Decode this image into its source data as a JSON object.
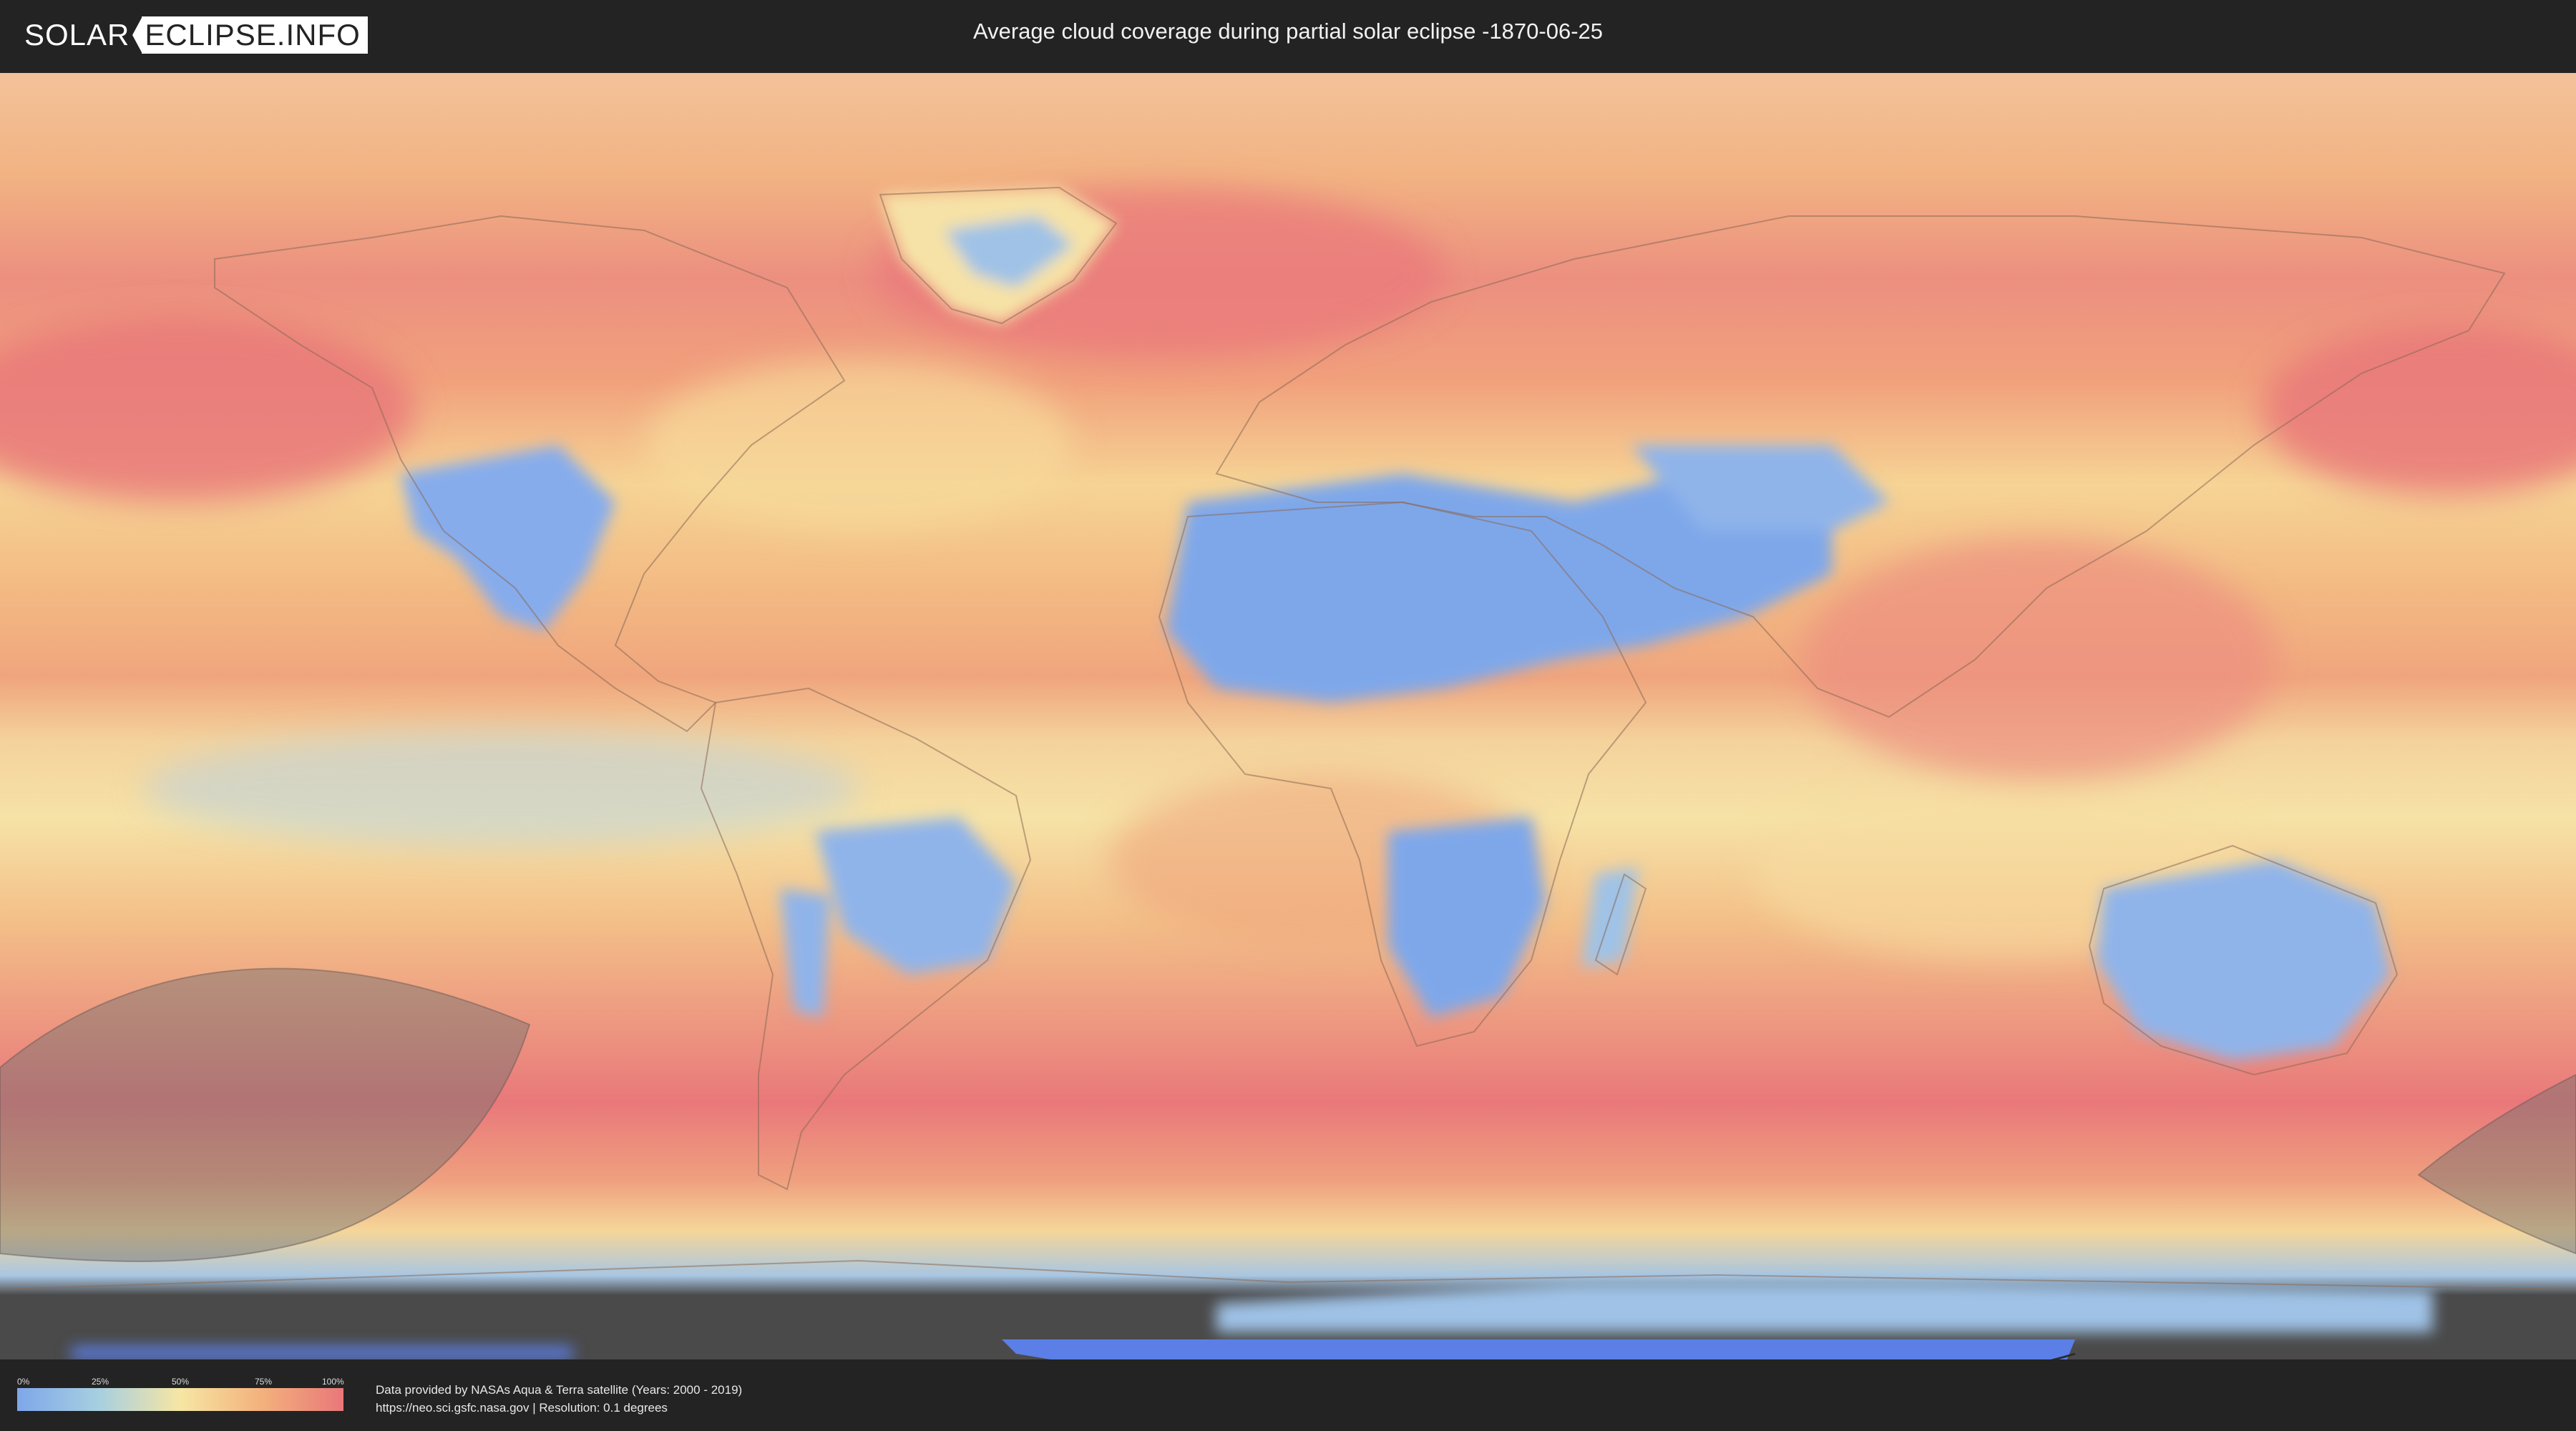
{
  "header": {
    "logo_left": "SOLAR",
    "logo_right": "ECLIPSE.INFO",
    "title": "Average cloud coverage during partial solar eclipse -1870-06-25"
  },
  "legend": {
    "ticks": [
      "0%",
      "25%",
      "50%",
      "75%",
      "100%"
    ],
    "colors": [
      "#7ea7ea",
      "#a7cfe0",
      "#f6e6a4",
      "#f3b17c",
      "#e9777a"
    ]
  },
  "footer": {
    "line1": "Data provided by NASAs Aqua & Terra satellite (Years: 2000 - 2019)",
    "line2": "https://neo.sci.gsfc.nasa.gov | Resolution: 0.1 degrees"
  },
  "map": {
    "type": "world cloud-coverage map, equirectangular projection",
    "colors": {
      "clear_sky": "#7ea7ea",
      "low": "#a7cfe0",
      "medium": "#f6e6a4",
      "high": "#f3b17c",
      "overcast": "#e9777a",
      "eclipse_shadow": "#6e6e6e",
      "out_of_data": "#4a4a4a",
      "antarctic_ice": "#5b7fe6"
    },
    "eclipse_visibility_zone": "southern Pacific Ocean, straddling the antimeridian"
  }
}
